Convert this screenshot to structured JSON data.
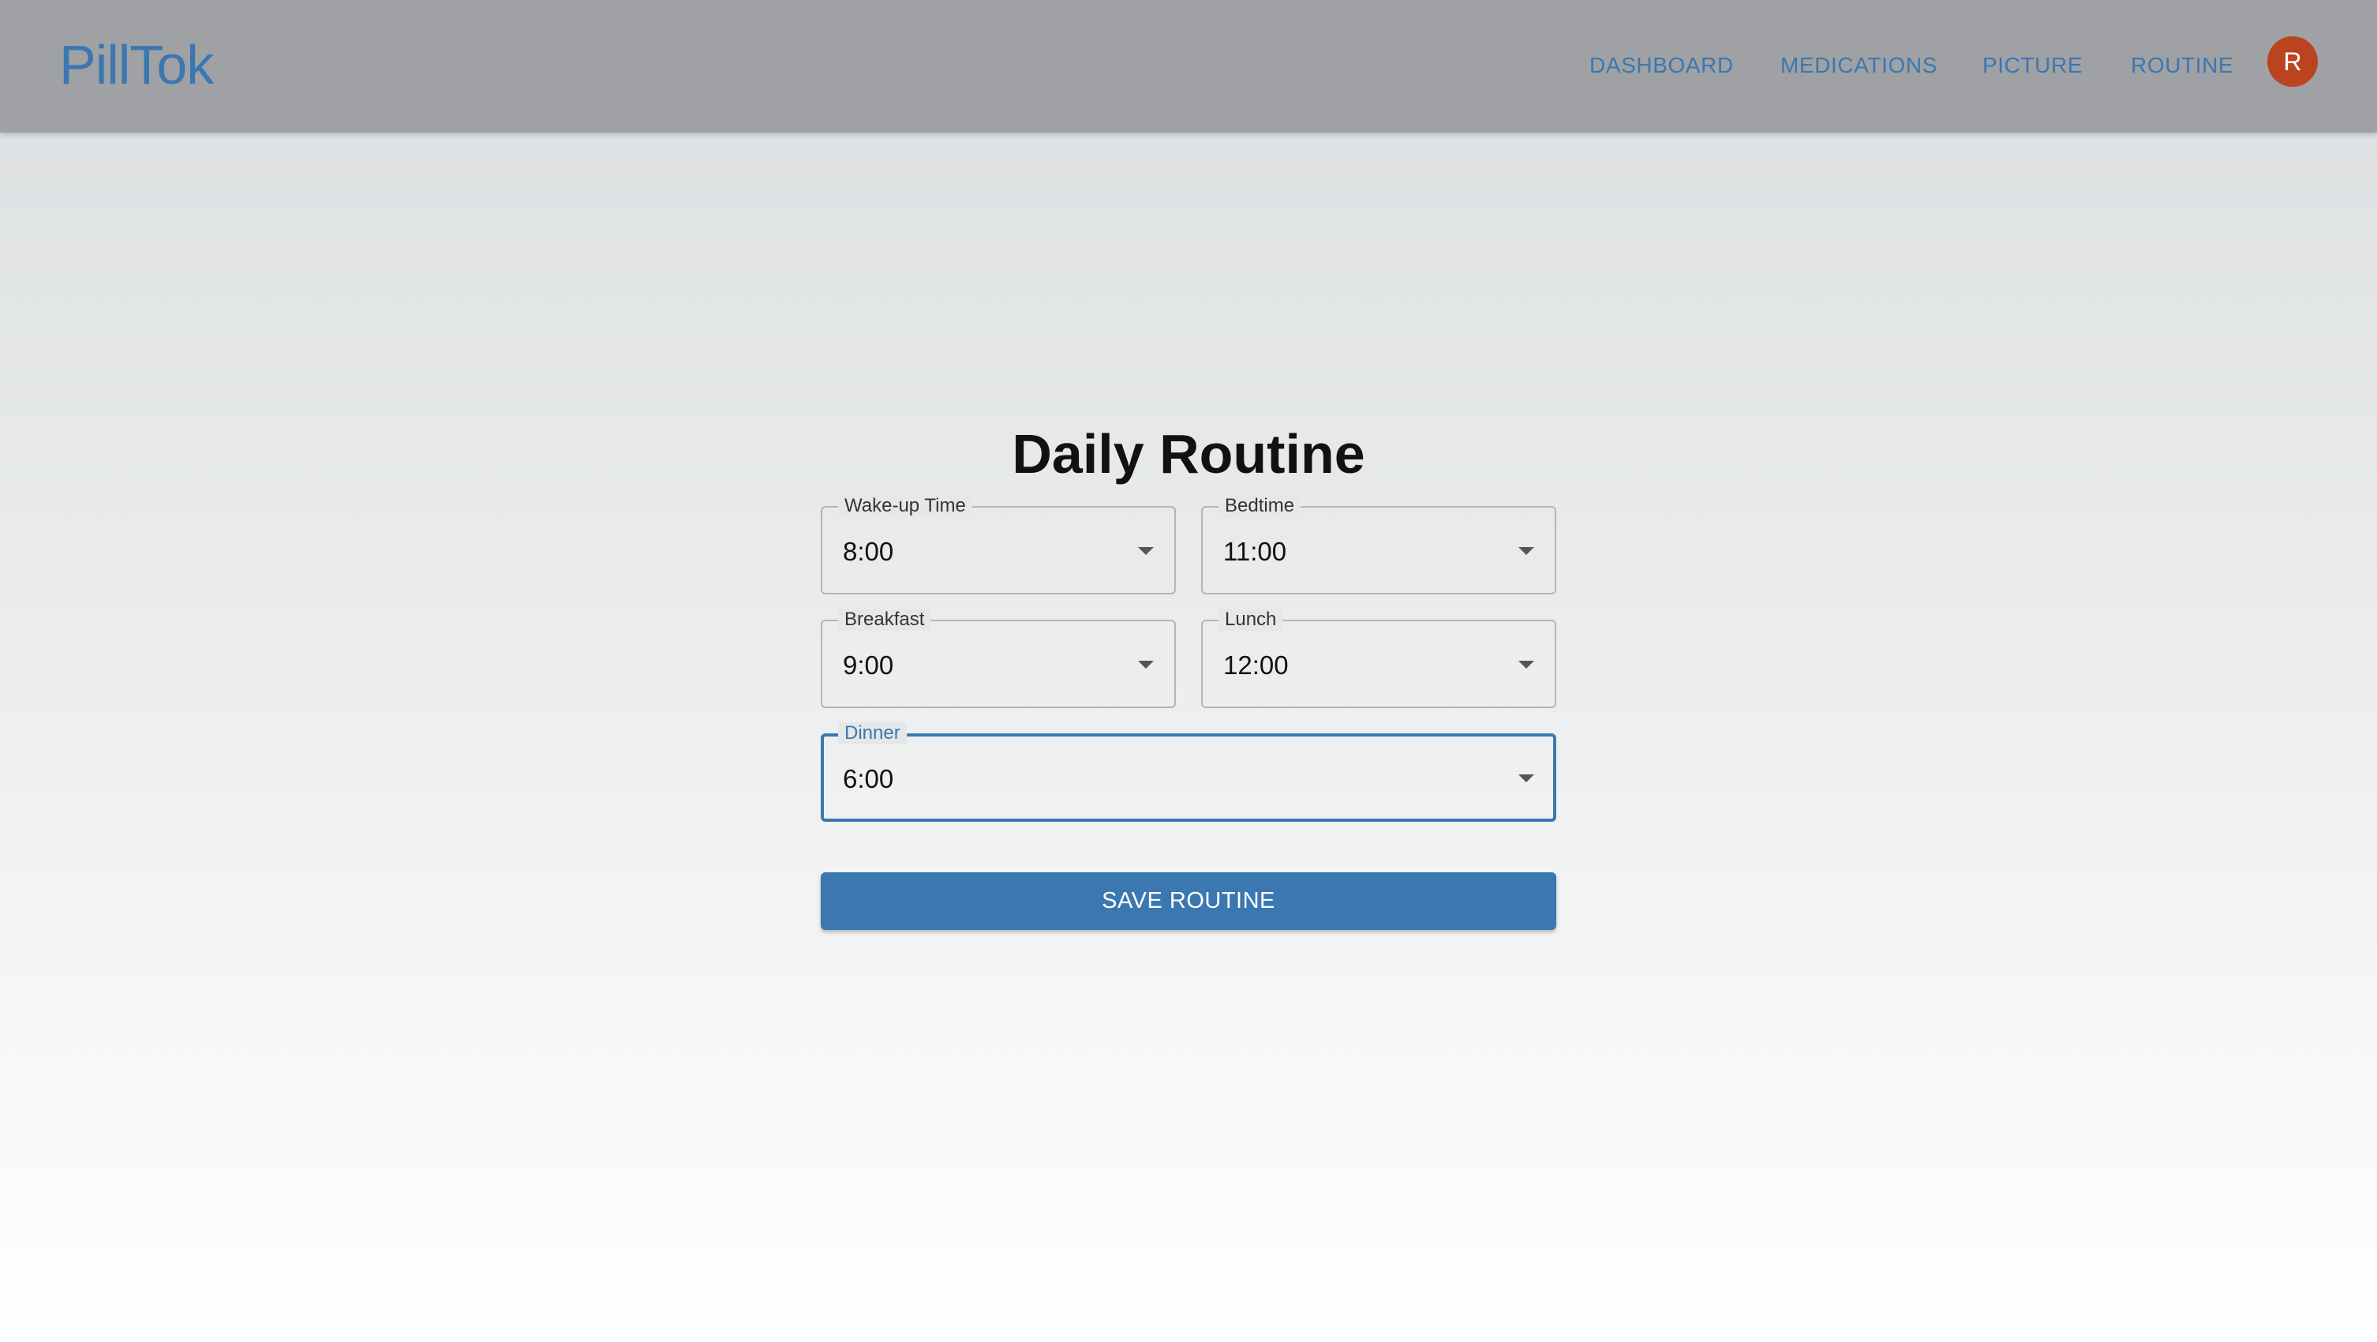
{
  "app": {
    "logo": "PillTok"
  },
  "nav": {
    "items": [
      {
        "label": "DASHBOARD"
      },
      {
        "label": "MEDICATIONS"
      },
      {
        "label": "PICTURE"
      },
      {
        "label": "ROUTINE"
      }
    ],
    "avatar_initial": "R"
  },
  "main": {
    "title": "Daily Routine",
    "fields": {
      "wakeup": {
        "label": "Wake-up Time",
        "value": "8:00"
      },
      "bedtime": {
        "label": "Bedtime",
        "value": "11:00"
      },
      "breakfast": {
        "label": "Breakfast",
        "value": "9:00"
      },
      "lunch": {
        "label": "Lunch",
        "value": "12:00"
      },
      "dinner": {
        "label": "Dinner",
        "value": "6:00"
      }
    },
    "save_label": "SAVE ROUTINE"
  },
  "colors": {
    "accent": "#3b77b0",
    "header_bg": "#9fa1a5",
    "avatar_bg": "#bc4320"
  },
  "icons": {
    "dropdown": "arrow-drop-down-icon"
  }
}
